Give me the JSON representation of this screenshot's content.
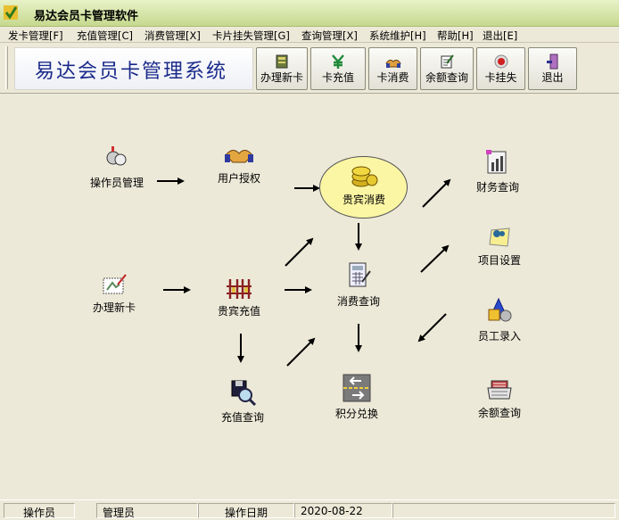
{
  "window": {
    "title": "易达会员卡管理软件"
  },
  "menu": [
    {
      "label": "发卡管理[F]"
    },
    {
      "label": "充值管理[C]"
    },
    {
      "label": "消费管理[X]"
    },
    {
      "label": "卡片挂失管理[G]"
    },
    {
      "label": "查询管理[X]"
    },
    {
      "label": "系统维护[H]"
    },
    {
      "label": "帮助[H]"
    },
    {
      "label": "退出[E]"
    }
  ],
  "toolbar": {
    "banner": "易达会员卡管理系统",
    "buttons": [
      {
        "label": "办理新卡",
        "icon": "card-stack-icon"
      },
      {
        "label": "卡充值",
        "icon": "yen-icon"
      },
      {
        "label": "卡消费",
        "icon": "hands-icon"
      },
      {
        "label": "余额查询",
        "icon": "notepad-icon"
      },
      {
        "label": "卡挂失",
        "icon": "red-disc-icon"
      },
      {
        "label": "退出",
        "icon": "exit-door-icon"
      }
    ]
  },
  "workflow": {
    "operator_admin": "操作员管理",
    "user_auth": "用户授权",
    "vip_consume": "贵宾消费",
    "finance_query": "财务查询",
    "new_card": "办理新卡",
    "vip_recharge": "贵宾充值",
    "consume_query": "消费查询",
    "project_settings": "项目设置",
    "employee_entry": "员工录入",
    "recharge_query": "充值查询",
    "points_exchange": "积分兑换",
    "balance_query": "余额查询"
  },
  "status": {
    "operator_label": "操作员",
    "operator_value": "管理员",
    "date_label": "操作日期",
    "date_value": "2020-08-22"
  },
  "colors": {
    "ellipse_fill": "#fbf6a4",
    "banner_text": "#1a2a8a",
    "titlebar": "#c6d98e"
  }
}
